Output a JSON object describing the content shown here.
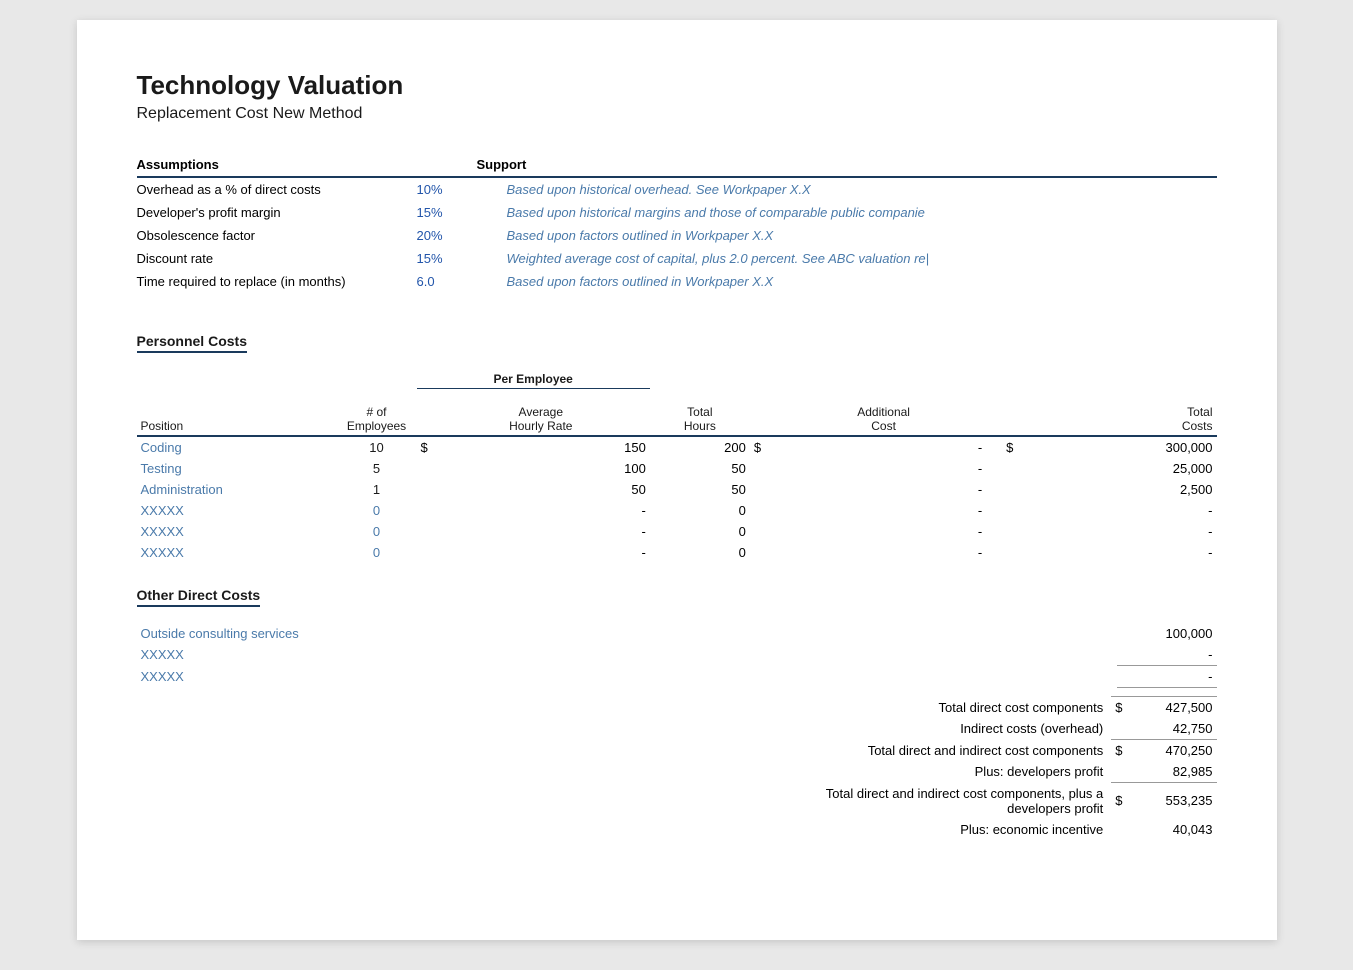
{
  "page": {
    "title": "Technology Valuation",
    "subtitle": "Replacement Cost New Method"
  },
  "assumptions": {
    "col_label": "Assumptions",
    "col_support": "Support",
    "rows": [
      {
        "label": "Overhead as a % of direct costs",
        "value": "10%",
        "support": "Based upon historical overhead.  See Workpaper X.X"
      },
      {
        "label": "Developer's profit margin",
        "value": "15%",
        "support": "Based upon historical margins and those of comparable public companie"
      },
      {
        "label": "Obsolescence factor",
        "value": "20%",
        "support": "Based upon factors outlined in Workpaper X.X"
      },
      {
        "label": "Discount rate",
        "value": "15%",
        "support": "Weighted average cost of capital, plus 2.0 percent.  See ABC valuation re|"
      },
      {
        "label": "Time required to replace (in months)",
        "value": "6.0",
        "support": "Based upon factors outlined in Workpaper X.X"
      }
    ]
  },
  "personnel": {
    "section_heading": "Personnel Costs",
    "group_header": "Per Employee",
    "col_position": "Position",
    "col_num_emp": "# of\nEmployees",
    "col_avg_rate": "Average\nHourly Rate",
    "col_total_hours": "Total\nHours",
    "col_add_cost": "Additional\nCost",
    "col_total_costs": "Total\nCosts",
    "rows": [
      {
        "position": "Coding",
        "num_emp": "10",
        "dollar1": "$",
        "avg_rate": "150",
        "total_hours": "200",
        "dollar2": "$",
        "add_cost": "-",
        "dollar3": "$",
        "total_costs": "300,000"
      },
      {
        "position": "Testing",
        "num_emp": "5",
        "dollar1": "",
        "avg_rate": "100",
        "total_hours": "50",
        "dollar2": "",
        "add_cost": "-",
        "dollar3": "",
        "total_costs": "25,000"
      },
      {
        "position": "Administration",
        "num_emp": "1",
        "dollar1": "",
        "avg_rate": "50",
        "total_hours": "50",
        "dollar2": "",
        "add_cost": "-",
        "dollar3": "",
        "total_costs": "2,500"
      },
      {
        "position": "XXXXX",
        "num_emp": "0",
        "dollar1": "",
        "avg_rate": "-",
        "total_hours": "0",
        "dollar2": "",
        "add_cost": "-",
        "dollar3": "",
        "total_costs": "-"
      },
      {
        "position": "XXXXX",
        "num_emp": "0",
        "dollar1": "",
        "avg_rate": "-",
        "total_hours": "0",
        "dollar2": "",
        "add_cost": "-",
        "dollar3": "",
        "total_costs": "-"
      },
      {
        "position": "XXXXX",
        "num_emp": "0",
        "dollar1": "",
        "avg_rate": "-",
        "total_hours": "0",
        "dollar2": "",
        "add_cost": "-",
        "dollar3": "",
        "total_costs": "-"
      }
    ]
  },
  "other_direct": {
    "section_heading": "Other Direct Costs",
    "rows": [
      {
        "label": "Outside consulting services",
        "amount": "100,000"
      },
      {
        "label": "XXXXX",
        "amount": "-"
      },
      {
        "label": "XXXXX",
        "amount": "-"
      }
    ]
  },
  "totals": {
    "rows": [
      {
        "label": "Total direct cost components",
        "dollar": "$",
        "amount": "427,500",
        "line": "top"
      },
      {
        "label": "Indirect costs (overhead)",
        "dollar": "",
        "amount": "42,750",
        "line": ""
      },
      {
        "label": "Total direct and indirect cost components",
        "dollar": "$",
        "amount": "470,250",
        "line": "top"
      },
      {
        "label": "Plus: developers profit",
        "dollar": "",
        "amount": "82,985",
        "line": ""
      },
      {
        "label": "Total direct and indirect cost components, plus a developers profit",
        "dollar": "$",
        "amount": "553,235",
        "line": "top"
      },
      {
        "label": "Plus: economic incentive",
        "dollar": "",
        "amount": "40,043",
        "line": ""
      }
    ]
  }
}
